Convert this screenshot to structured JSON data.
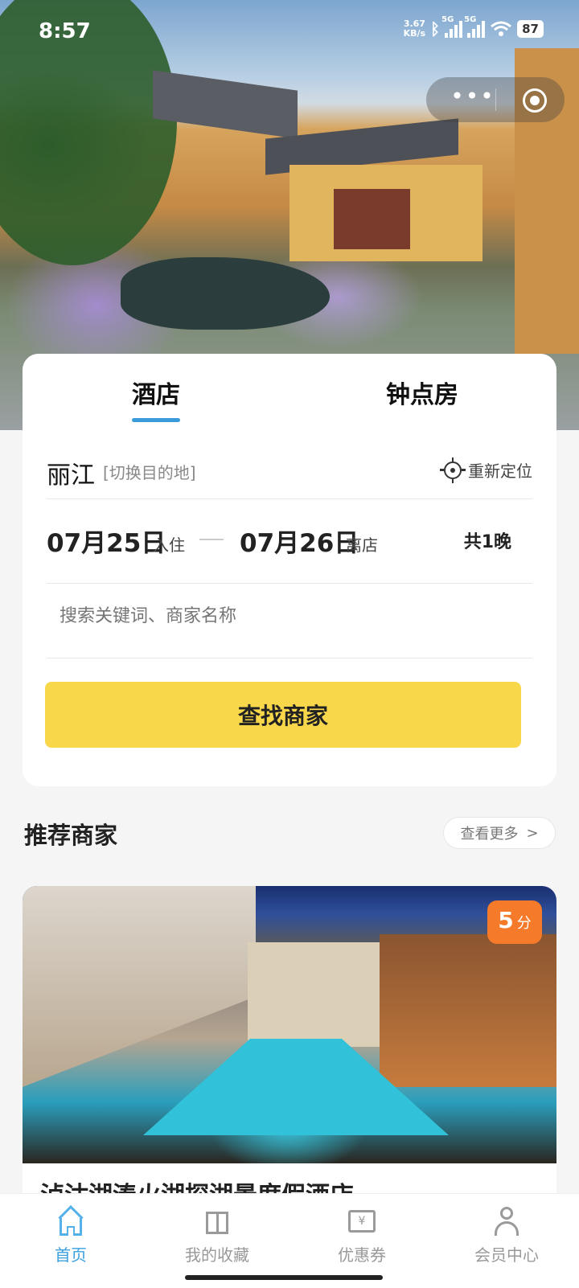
{
  "status_bar": {
    "time": "8:57",
    "net_speed_value": "3.67",
    "net_speed_unit": "KB/s",
    "sim1_label": "5G",
    "sim2_label": "5G",
    "battery": "87"
  },
  "capsule": {
    "more_label": "•••",
    "more_icon": "more-dots-icon",
    "close_icon": "close-target-icon"
  },
  "tabs": [
    {
      "label": "酒店",
      "active": true
    },
    {
      "label": "钟点房",
      "active": false
    }
  ],
  "location": {
    "city": "丽江",
    "switch_label": "[切换目的地]",
    "relocate_label": "重新定位"
  },
  "dates": {
    "checkin": "07月25日",
    "checkin_label": "入住",
    "checkout": "07月26日",
    "checkout_label": "离店",
    "nights": "共1晚"
  },
  "search": {
    "placeholder": "搜索关键词、商家名称"
  },
  "find_button": "查找商家",
  "recommended": {
    "title": "推荐商家",
    "more_label": "查看更多",
    "more_arrow": ">",
    "hotel": {
      "score": "5",
      "score_unit": "分",
      "name": "泸沽湖湊火湖探湖景度假酒店"
    }
  },
  "tabbar": [
    {
      "label": "首页",
      "icon": "home-icon",
      "active": true
    },
    {
      "label": "我的收藏",
      "icon": "box-icon",
      "active": false
    },
    {
      "label": "优惠券",
      "icon": "coupon-icon",
      "active": false
    },
    {
      "label": "会员中心",
      "icon": "user-icon",
      "active": false
    }
  ],
  "colors": {
    "accent_blue": "#3aa0e0",
    "button_yellow": "#f8d84a",
    "score_orange": "#f57a2a"
  }
}
